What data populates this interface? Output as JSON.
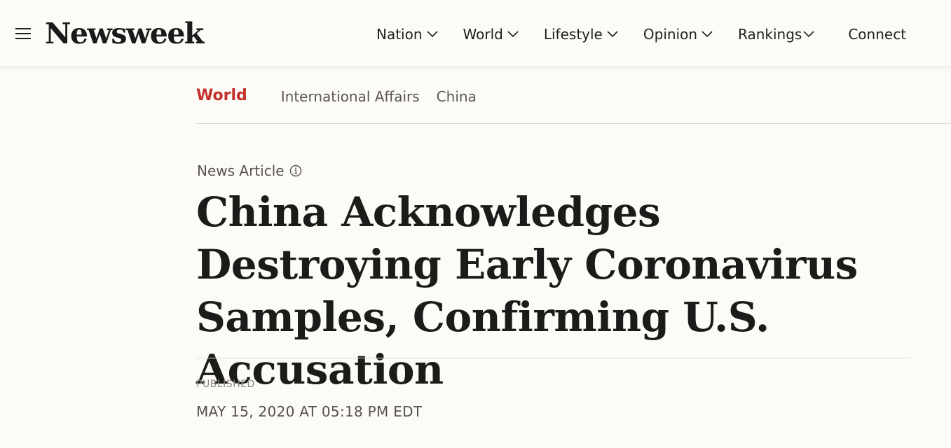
{
  "header": {
    "logo": "Newsweek",
    "nav": [
      {
        "label": "Nation",
        "icon": "chevron-down-icon"
      },
      {
        "label": "World",
        "icon": "chevron-down-icon"
      },
      {
        "label": "Lifestyle",
        "icon": "chevron-down-icon"
      },
      {
        "label": "Opinion",
        "icon": "chevron-down-icon"
      },
      {
        "label": "Rankings",
        "icon": "chevron-down-icon"
      },
      {
        "label": "Connect"
      }
    ]
  },
  "breadcrumb": {
    "section": "World",
    "tags": [
      "International Affairs",
      "China"
    ]
  },
  "article": {
    "type_label": "News Article",
    "type_icon": "info-icon",
    "headline": "China Acknowledges Destroying Early Coronavirus Samples, Confirming U.S. Accusation",
    "published_label": "PUBLISHED",
    "published_date": "MAY 15, 2020 AT 05:18 PM EDT"
  },
  "colors": {
    "background": "#fcfbf7",
    "accent": "#c5302a",
    "text": "#1c1b19"
  }
}
